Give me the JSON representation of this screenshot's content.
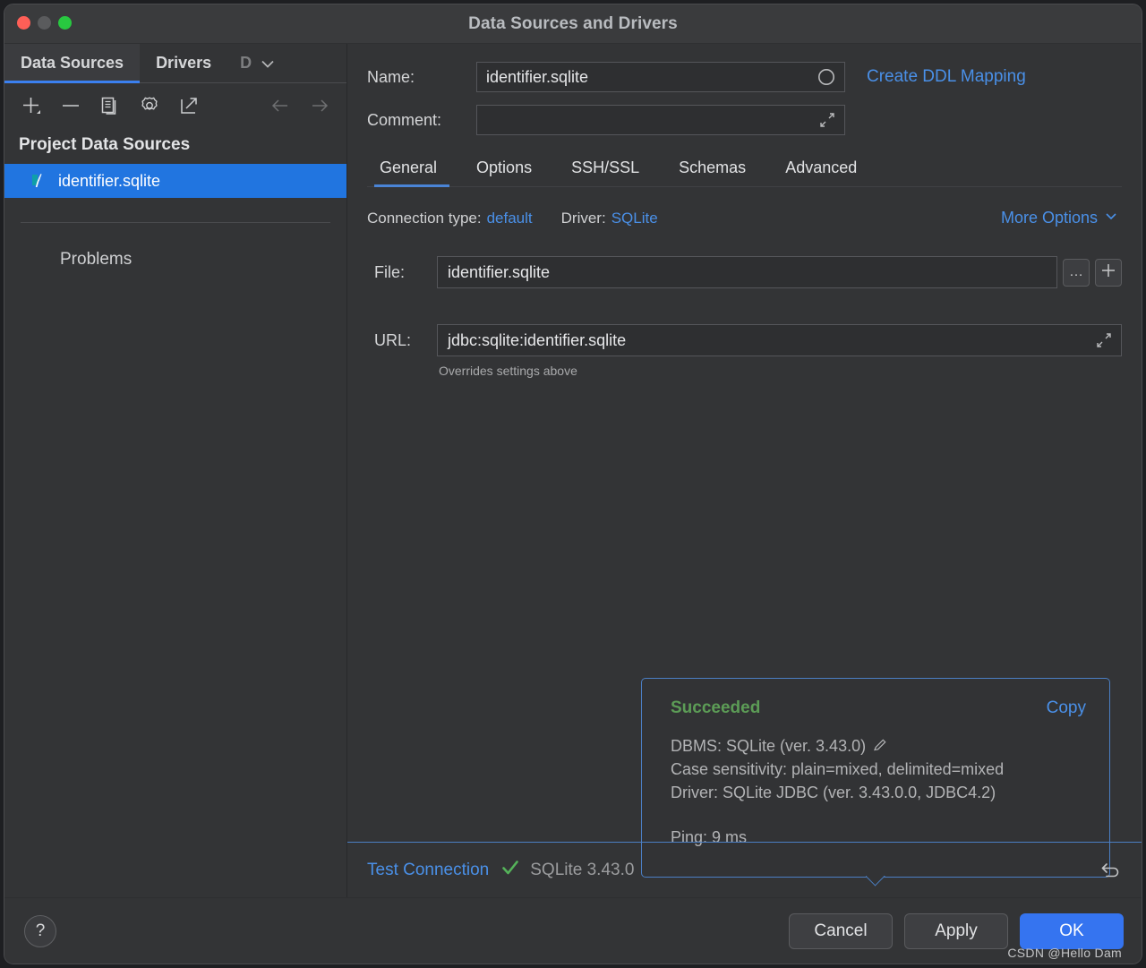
{
  "window": {
    "title": "Data Sources and Drivers",
    "traffic_lights": [
      "close",
      "minimize",
      "zoom"
    ]
  },
  "sidebar": {
    "tabs": [
      {
        "label": "Data Sources",
        "active": true
      },
      {
        "label": "Drivers",
        "active": false
      },
      {
        "label": "D",
        "active": false,
        "truncated": true
      }
    ],
    "overflow_icon": "chevron-down-icon",
    "toolbar": [
      {
        "icon": "add-icon",
        "name": "add-data-source-button"
      },
      {
        "icon": "remove-icon",
        "name": "remove-data-source-button"
      },
      {
        "icon": "duplicate-icon",
        "name": "duplicate-data-source-button"
      },
      {
        "icon": "gear-icon",
        "name": "data-source-properties-button"
      },
      {
        "icon": "external-link-icon",
        "name": "open-external-button"
      },
      {
        "icon": "arrow-left-icon",
        "name": "navigate-back-button"
      },
      {
        "icon": "arrow-right-icon",
        "name": "navigate-forward-button"
      }
    ],
    "group_title": "Project Data Sources",
    "items": [
      {
        "label": "identifier.sqlite",
        "icon": "sqlite-feather-icon",
        "selected": true
      }
    ],
    "problems_label": "Problems"
  },
  "details": {
    "name_label": "Name:",
    "name_value": "identifier.sqlite",
    "name_status_icon": "circle-icon",
    "comment_label": "Comment:",
    "comment_value": "",
    "comment_expand_icon": "expand-diagonal-icon",
    "ddl_mapping_link": "Create DDL Mapping",
    "tabs": [
      {
        "label": "General",
        "active": true
      },
      {
        "label": "Options",
        "active": false
      },
      {
        "label": "SSH/SSL",
        "active": false
      },
      {
        "label": "Schemas",
        "active": false
      },
      {
        "label": "Advanced",
        "active": false
      }
    ],
    "connection_type_label": "Connection type:",
    "connection_type_value": "default",
    "driver_label": "Driver:",
    "driver_value": "SQLite",
    "more_options_label": "More Options",
    "more_options_icon": "chevron-down-icon",
    "file_label": "File:",
    "file_value": "identifier.sqlite",
    "file_browse_label": "…",
    "file_add_label": "+",
    "url_label": "URL:",
    "url_value": "jdbc:sqlite:identifier.sqlite",
    "url_expand_icon": "expand-diagonal-icon",
    "overrides_note": "Overrides settings above"
  },
  "popup": {
    "status": "Succeeded",
    "copy_label": "Copy",
    "dbms_line": "DBMS: SQLite (ver. 3.43.0)",
    "edit_icon": "pencil-icon",
    "case_sensitivity_line": "Case sensitivity: plain=mixed, delimited=mixed",
    "driver_line": "Driver: SQLite JDBC (ver. 3.43.0.0, JDBC4.2)",
    "ping_line": "Ping: 9 ms"
  },
  "test_bar": {
    "test_connection_label": "Test Connection",
    "check_icon": "checkmark-icon",
    "version_text": "SQLite 3.43.0",
    "revert_icon": "revert-icon"
  },
  "footer": {
    "help_label": "?",
    "cancel_label": "Cancel",
    "apply_label": "Apply",
    "ok_label": "OK",
    "watermark": "CSDN @Hello Dam"
  },
  "colors": {
    "accent_blue": "#3574f0",
    "link_blue": "#4a90e8",
    "selection_blue": "#2175e0",
    "success_green": "#5c9c56",
    "check_green": "#55b35a",
    "window_bg": "#333436",
    "titlebar_bg": "#3a3b3d",
    "field_bg": "#2e2f31",
    "popup_border": "#4b7fc4"
  }
}
